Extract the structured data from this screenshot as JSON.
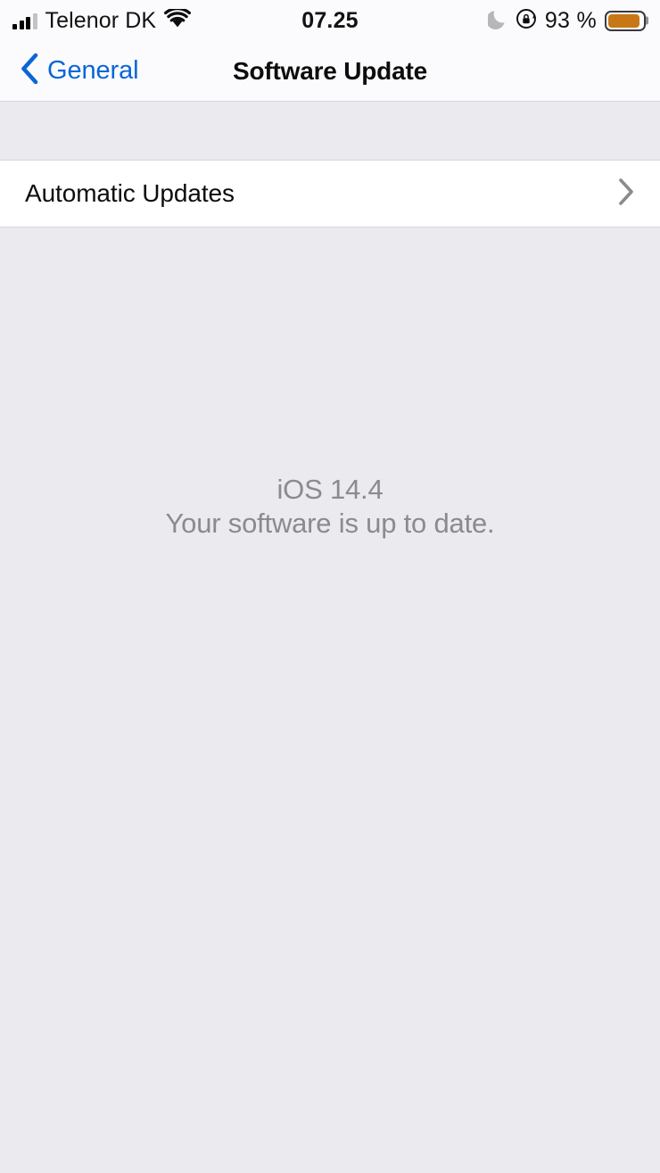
{
  "status_bar": {
    "carrier": "Telenor DK",
    "time": "07.25",
    "battery_percent": "93 %",
    "battery_level": 93,
    "signal_bars_filled": 3,
    "signal_bars_total": 4,
    "icons": {
      "signal": "cellular-signal-icon",
      "wifi": "wifi-icon",
      "do_not_disturb": "moon-icon",
      "rotation_lock": "rotation-lock-icon",
      "battery": "battery-icon"
    },
    "colors": {
      "battery_fill": "#c87716",
      "text": "#121212"
    }
  },
  "nav_bar": {
    "back_label": "General",
    "back_icon": "back-chevron-icon",
    "title": "Software Update",
    "accent_color": "#0a66d6"
  },
  "settings": {
    "rows": [
      {
        "label": "Automatic Updates",
        "accessory": "disclosure-chevron-icon"
      }
    ]
  },
  "update_status": {
    "version": "iOS 14.4",
    "message": "Your software is up to date.",
    "text_color": "#8a8a90"
  },
  "theme": {
    "background": "#eaeaef",
    "surface": "#ffffff",
    "separator": "#d6d6db"
  }
}
